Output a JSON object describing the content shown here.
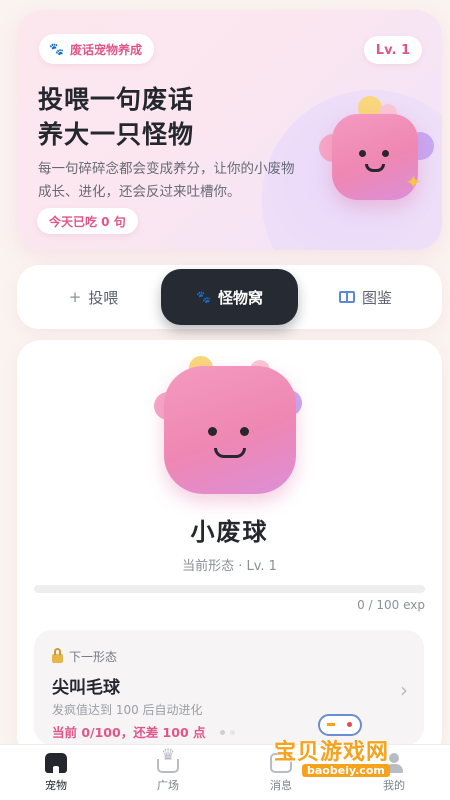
{
  "hero": {
    "tag_label": "废话宠物养成",
    "level_badge": "Lv. 1",
    "title_line1": "投喂一句废话",
    "title_line2": "养大一只怪物",
    "desc_line1": "每一句碎碎念都会变成养分，让你的小废物",
    "desc_line2": "成长、进化，还会反过来吐槽你。",
    "eaten_label": "今天已吃 0 句"
  },
  "tabs": [
    {
      "label": "投喂",
      "icon": "plus-icon"
    },
    {
      "label": "怪物窝",
      "icon": "paw-icon",
      "active": true
    },
    {
      "label": "图鉴",
      "icon": "book-icon"
    }
  ],
  "pet": {
    "name": "小废球",
    "stage": "当前形态 · Lv. 1",
    "exp_text": "0 / 100 exp",
    "exp_fraction": 0
  },
  "next_form": {
    "label": "下一形态",
    "name": "尖叫毛球",
    "desc": "发疯值达到 100 后自动进化",
    "progress": "当前 0/100，还差 100 点"
  },
  "bottom_nav": [
    {
      "label": "宠物",
      "icon": "home-icon",
      "active": true
    },
    {
      "label": "广场",
      "icon": "crown-icon"
    },
    {
      "label": "消息",
      "icon": "message-icon"
    },
    {
      "label": "我的",
      "icon": "user-icon"
    }
  ],
  "watermark": {
    "text": "宝贝游戏网",
    "url": "baobeiy.com"
  },
  "colors": {
    "accent": "#e0568a",
    "dark": "#252a33",
    "monster_pink": "#ef87b3"
  }
}
